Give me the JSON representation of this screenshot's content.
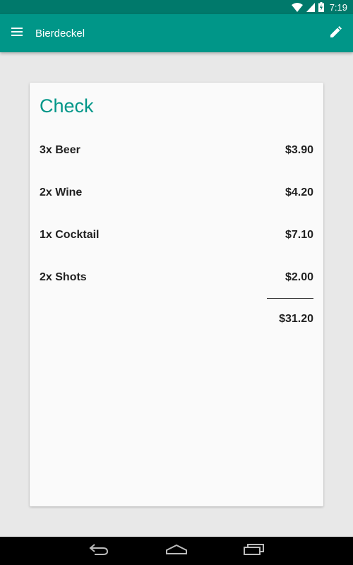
{
  "status_bar": {
    "time": "7:19",
    "icons": [
      "wifi-icon",
      "cell-signal-icon",
      "battery-charging-icon"
    ]
  },
  "app_bar": {
    "title": "Bierdeckel",
    "menu_icon": "menu-icon",
    "edit_icon": "pencil-icon",
    "color": "#009688"
  },
  "check": {
    "title": "Check",
    "items": [
      {
        "label": "3x Beer",
        "price": "$3.90"
      },
      {
        "label": "2x Wine",
        "price": "$4.20"
      },
      {
        "label": "1x Cocktail",
        "price": "$7.10"
      },
      {
        "label": "2x Shots",
        "price": "$2.00"
      }
    ],
    "total": "$31.20"
  },
  "nav_bar": {
    "icons": [
      "back-icon",
      "home-icon",
      "recents-icon"
    ]
  }
}
